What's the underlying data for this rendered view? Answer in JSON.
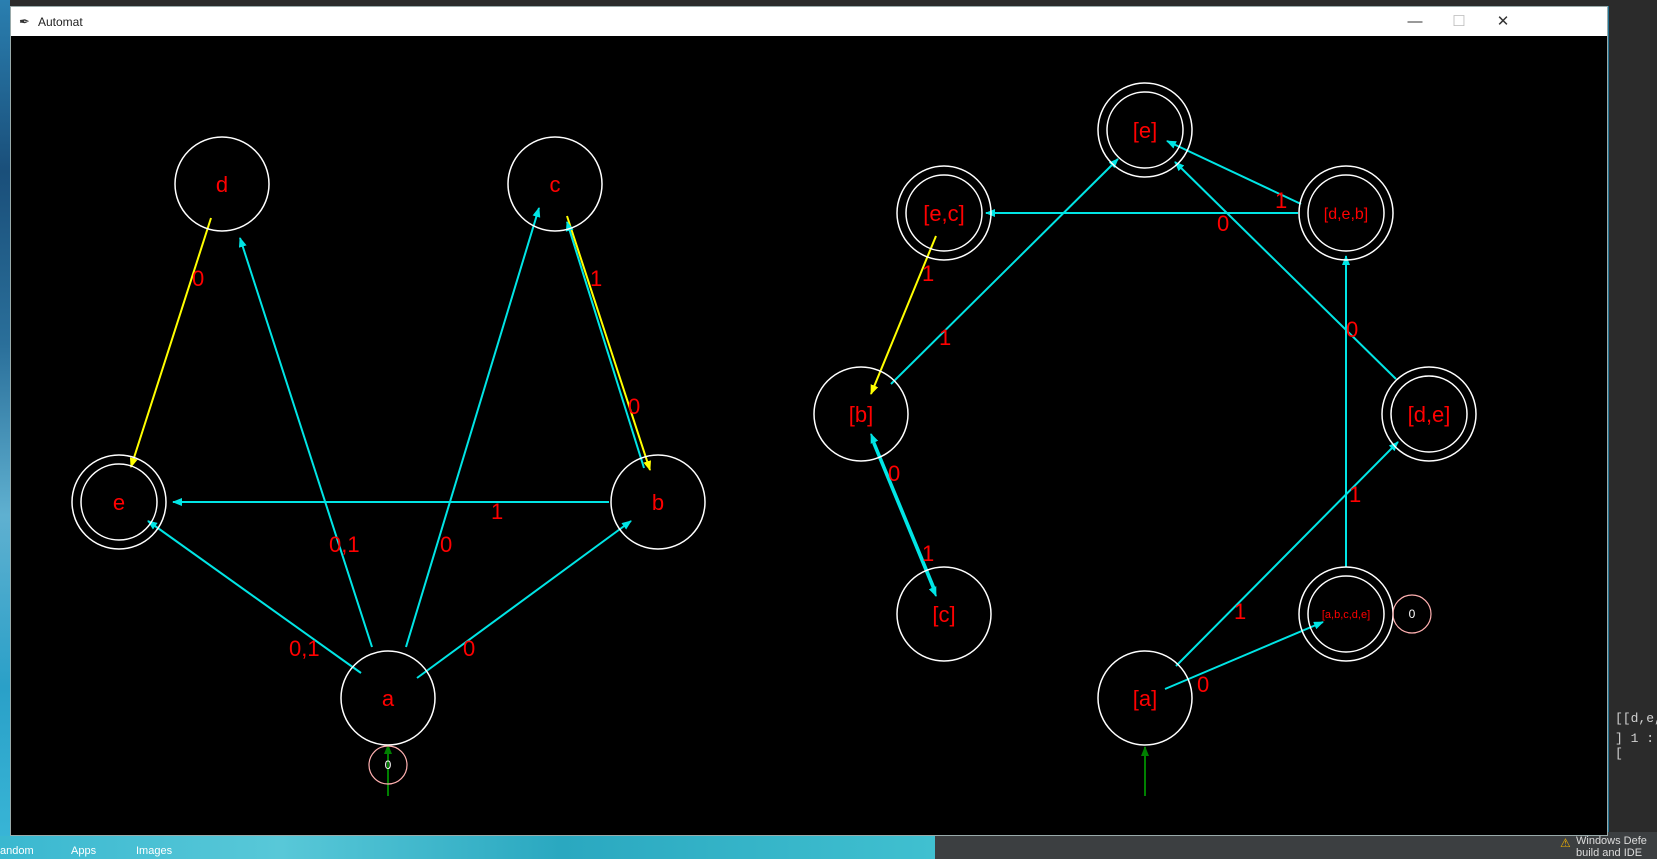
{
  "window": {
    "title": "Automat"
  },
  "desktop": {
    "bottom_labels": [
      "andom",
      "Apps",
      "Images"
    ],
    "right_lines": [
      "[[d,e,",
      "] 1 :["
    ],
    "notification": {
      "line1": "Windows Defe",
      "line2": "build and IDE"
    }
  },
  "colors": {
    "edge": "#00e5e5",
    "highlight": "#ffff00",
    "label": "#ff0000",
    "node": "#ffffff",
    "start_arrow": "#008000",
    "start_circle": "#ffb0b0"
  },
  "left_automaton": {
    "nodes": [
      {
        "id": "a",
        "label": "a",
        "final": false
      },
      {
        "id": "b",
        "label": "b",
        "final": false
      },
      {
        "id": "c",
        "label": "c",
        "final": false
      },
      {
        "id": "d",
        "label": "d",
        "final": false
      },
      {
        "id": "e",
        "label": "e",
        "final": true
      }
    ],
    "start_marker": "0",
    "edge_labels": [
      "0",
      "1",
      "0",
      "1",
      "0,1",
      "0",
      "0,1",
      "0"
    ]
  },
  "right_automaton": {
    "nodes": [
      {
        "id": "A",
        "label": "[a]",
        "final": false
      },
      {
        "id": "ABCDE",
        "label": "[a,b,c,d,e]",
        "final": true
      },
      {
        "id": "DEB",
        "label": "[d,e,b]",
        "final": true
      },
      {
        "id": "E",
        "label": "[e]",
        "final": true
      },
      {
        "id": "EC",
        "label": "[e,c]",
        "final": true
      },
      {
        "id": "B",
        "label": "[b]",
        "final": false
      },
      {
        "id": "C",
        "label": "[c]",
        "final": false
      },
      {
        "id": "DE",
        "label": "[d,e]",
        "final": true
      }
    ],
    "loop_marker": "0",
    "edge_labels": [
      "1",
      "0",
      "0",
      "1",
      "1",
      "1",
      "0",
      "1",
      "0",
      "1",
      "0"
    ]
  }
}
